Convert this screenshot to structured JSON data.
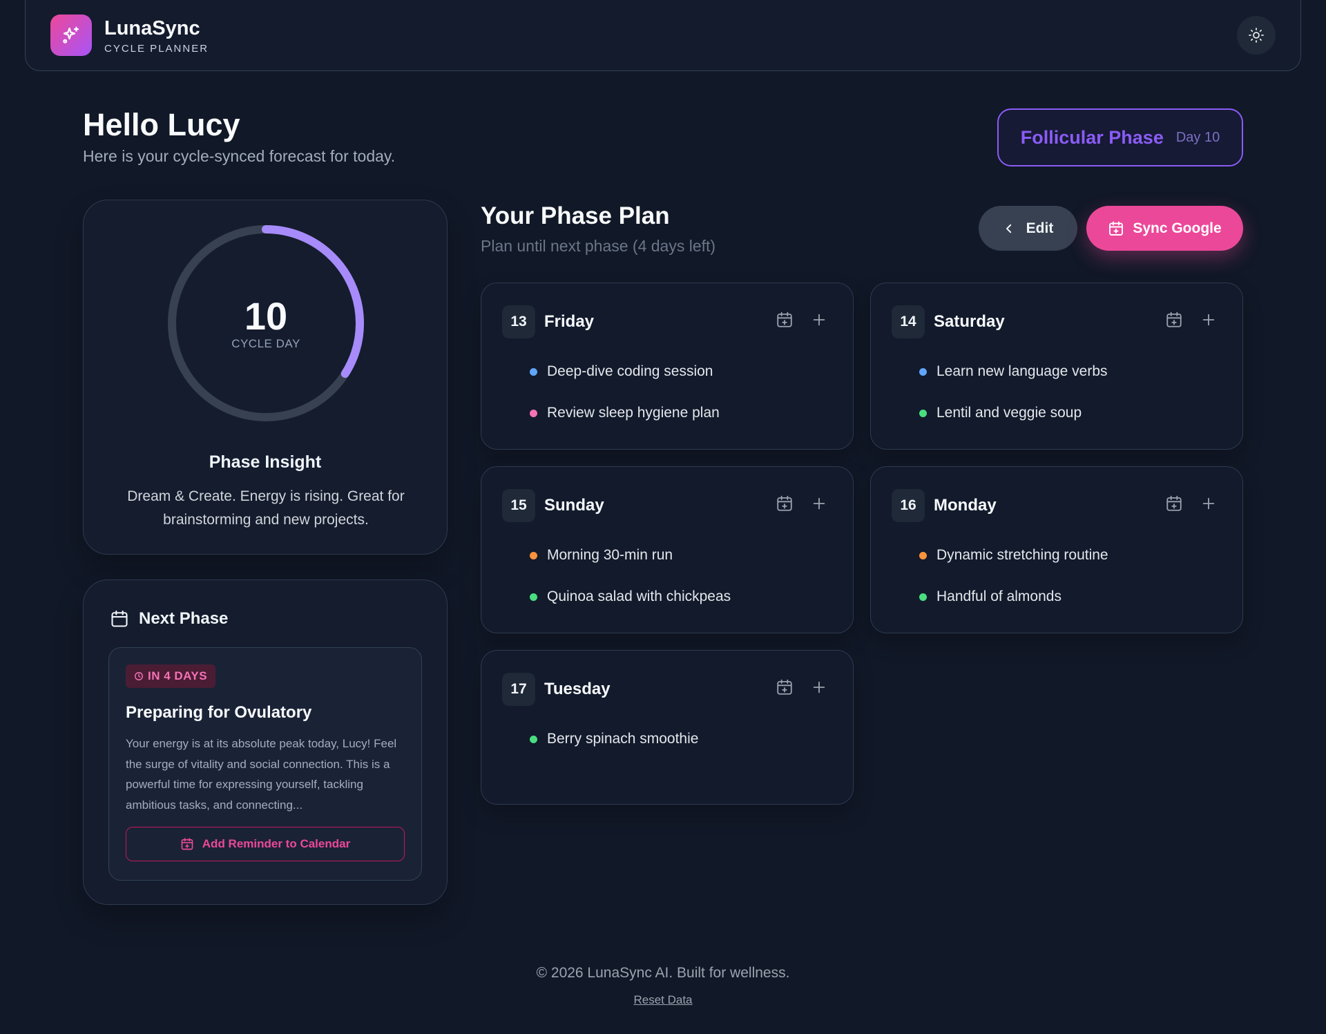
{
  "app": {
    "name": "LunaSync",
    "subtitle": "CYCLE PLANNER"
  },
  "greeting": {
    "title": "Hello Lucy",
    "subtitle": "Here is your cycle-synced forecast for today."
  },
  "phase": {
    "name": "Follicular Phase",
    "day": "Day 10"
  },
  "cycle": {
    "day": "10",
    "label": "CYCLE DAY",
    "progress": 0.34
  },
  "insight": {
    "title": "Phase Insight",
    "text": "Dream & Create. Energy is rising. Great for brainstorming and new projects."
  },
  "next_phase": {
    "title": "Next Phase",
    "badge": "IN 4 DAYS",
    "heading": "Preparing for Ovulatory",
    "description": "Your energy is at its absolute peak today, Lucy! Feel the surge of vitality and social connection. This is a powerful time for expressing yourself, tackling ambitious tasks, and connecting...",
    "button": "Add Reminder to Calendar"
  },
  "plan": {
    "title": "Your Phase Plan",
    "subtitle": "Plan until next phase (4 days left)",
    "edit_label": "Edit",
    "sync_label": "Sync Google",
    "days": [
      {
        "num": "13",
        "name": "Friday",
        "tasks": [
          {
            "text": "Deep-dive coding session",
            "color": "#60a5fa"
          },
          {
            "text": "Review sleep hygiene plan",
            "color": "#f472b6"
          }
        ]
      },
      {
        "num": "14",
        "name": "Saturday",
        "tasks": [
          {
            "text": "Learn new language verbs",
            "color": "#60a5fa"
          },
          {
            "text": "Lentil and veggie soup",
            "color": "#4ade80"
          }
        ]
      },
      {
        "num": "15",
        "name": "Sunday",
        "tasks": [
          {
            "text": "Morning 30-min run",
            "color": "#fb923c"
          },
          {
            "text": "Quinoa salad with chickpeas",
            "color": "#4ade80"
          }
        ]
      },
      {
        "num": "16",
        "name": "Monday",
        "tasks": [
          {
            "text": "Dynamic stretching routine",
            "color": "#fb923c"
          },
          {
            "text": "Handful of almonds",
            "color": "#4ade80"
          }
        ]
      },
      {
        "num": "17",
        "name": "Tuesday",
        "tasks": [
          {
            "text": "Berry spinach smoothie",
            "color": "#4ade80"
          }
        ]
      }
    ]
  },
  "footer": {
    "text": "© 2026 LunaSync AI. Built for wellness.",
    "reset": "Reset Data"
  },
  "colors": {
    "accent": "#8b5cf6",
    "pink": "#ec4899",
    "background": "#111827"
  }
}
